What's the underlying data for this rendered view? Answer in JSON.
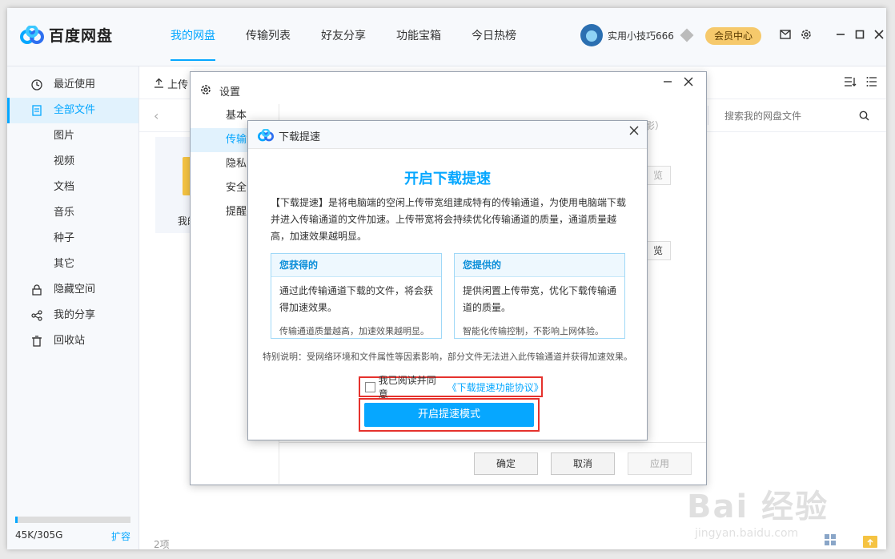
{
  "app": {
    "brand": "百度网盘"
  },
  "nav": {
    "tabs": [
      "我的网盘",
      "传输列表",
      "好友分享",
      "功能宝箱",
      "今日热榜"
    ],
    "active": 0
  },
  "user": {
    "name": "实用小技巧666",
    "vip_label": "会员中心"
  },
  "sidebar": {
    "items": [
      {
        "label": "最近使用",
        "icon": "clock-icon"
      },
      {
        "label": "全部文件",
        "icon": "file-icon",
        "active": true
      },
      {
        "label": "图片"
      },
      {
        "label": "视频"
      },
      {
        "label": "文档"
      },
      {
        "label": "音乐"
      },
      {
        "label": "种子"
      },
      {
        "label": "其它"
      },
      {
        "label": "隐藏空间",
        "icon": "lock-icon"
      },
      {
        "label": "我的分享",
        "icon": "share-icon"
      },
      {
        "label": "回收站",
        "icon": "trash-icon"
      }
    ],
    "storage_text": "45K/305G",
    "storage_used_fraction": 0.02,
    "expand_label": "扩容"
  },
  "main": {
    "upload_label": "上传",
    "search_placeholder": "搜索我的网盘文件",
    "folder_label": "我的",
    "item_count": "2项",
    "ghost_paren": "影）",
    "ghost_btn": "览"
  },
  "settings": {
    "title": "设置",
    "tabs": [
      "基本",
      "传输",
      "隐私",
      "安全",
      "提醒"
    ],
    "active_tab": 1,
    "ok_label": "确定",
    "cancel_label": "取消",
    "apply_label": "应用"
  },
  "dialog": {
    "title": "下载提速",
    "heading": "开启下载提速",
    "description": "【下载提速】是将电脑端的空闲上传带宽组建成特有的传输通道，为使用电脑端下载并进入传输通道的文件加速。上传带宽将会持续优化传输通道的质量，通道质量越高，加速效果越明显。",
    "benefits": [
      {
        "title": "您获得的",
        "body": "通过此传输通道下载的文件，将会获得加速效果。",
        "note": "传输通道质量越高，加速效果越明显。"
      },
      {
        "title": "您提供的",
        "body": "提供闲置上传带宽，优化下载传输通道的质量。",
        "note": "智能化传输控制，不影响上网体验。"
      }
    ],
    "notice": "特别说明：受网络环境和文件属性等因素影响，部分文件无法进入此传输通道并获得加速效果。",
    "agree_text": "我已阅读并同意",
    "agree_link": "《下载提速功能协议》",
    "enable_label": "开启提速模式"
  },
  "watermark": {
    "text": "Bai 经验",
    "sub": "jingyan.baidu.com"
  },
  "colors": {
    "accent": "#06a7ff",
    "highlight": "#e5322d",
    "vip": "#f6c96b"
  }
}
